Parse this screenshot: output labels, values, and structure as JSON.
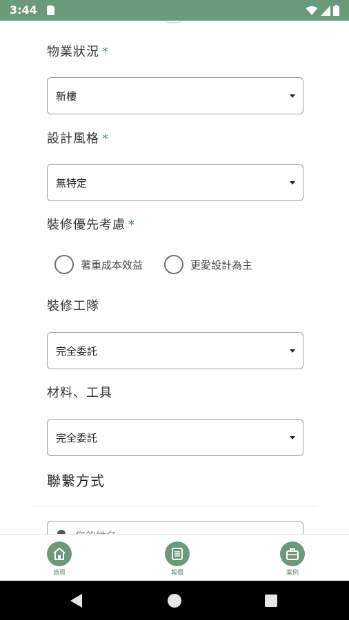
{
  "status_bar": {
    "time": "3:44",
    "icons": [
      "sim-card-icon",
      "wifi-icon",
      "signal-icon",
      "battery-icon"
    ]
  },
  "form": {
    "property_status": {
      "label": "物業狀況",
      "required_mark": "*",
      "value": "新樓"
    },
    "design_style": {
      "label": "設計風格",
      "required_mark": "*",
      "value": "無特定"
    },
    "renovation_priority": {
      "label": "裝修優先考慮",
      "required_mark": "*",
      "options": [
        "著重成本效益",
        "更愛設計為主"
      ],
      "selected": null
    },
    "renovation_team": {
      "label": "裝修工隊",
      "value": "完全委託"
    },
    "materials_tools": {
      "label": "材料、工具",
      "value": "完全委託"
    },
    "contact_section": {
      "title": "聯繫方式"
    },
    "name_input": {
      "placeholder": "您的姓名"
    }
  },
  "bottom_nav": {
    "items": [
      {
        "label": "首頁",
        "icon": "home-icon"
      },
      {
        "label": "報價",
        "icon": "list-icon"
      },
      {
        "label": "案例",
        "icon": "briefcase-icon"
      }
    ]
  },
  "colors": {
    "primary": "#6b9a7a",
    "accent_text": "#5c8d72",
    "status_bar": "#6b9a7a"
  }
}
